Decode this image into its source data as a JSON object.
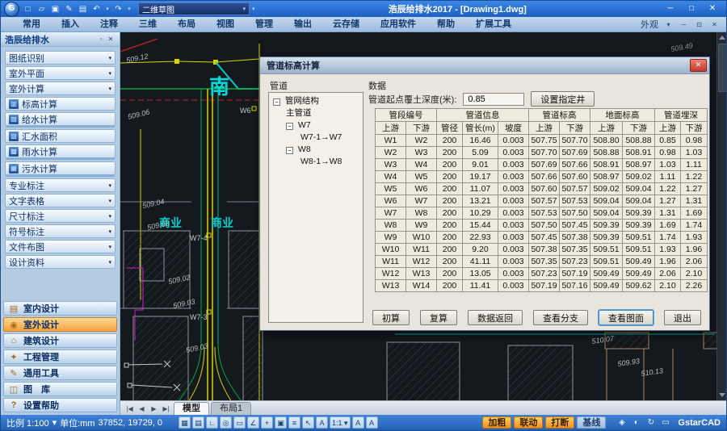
{
  "window": {
    "title": "浩辰给排水2017 - [Drawing1.dwg]",
    "workspace": "二维草图",
    "qat_icons": [
      "□",
      "▱",
      "▣",
      "✎",
      "▤"
    ],
    "undo": "↶",
    "redo": "↷",
    "min": "─",
    "max": "□",
    "close": "✕"
  },
  "ribbon": {
    "tabs": [
      "常用",
      "插入",
      "注释",
      "三维",
      "布局",
      "视图",
      "管理",
      "输出",
      "云存储",
      "应用软件",
      "帮助",
      "扩展工具"
    ],
    "appearance": "外观",
    "appearance_arrow": "▾",
    "mini": [
      "─",
      "⊡",
      "✕"
    ]
  },
  "sidebar": {
    "title": "浩辰给排水",
    "options_icon": "▫",
    "close_icon": "✕",
    "items": [
      {
        "label": "图纸识别",
        "arrow": "▾",
        "icon": "",
        "cls": "grp"
      },
      {
        "label": "室外平面",
        "arrow": "▾",
        "icon": "",
        "cls": "grp"
      },
      {
        "label": "室外计算",
        "arrow": "▾",
        "icon": "",
        "cls": "grp"
      },
      {
        "label": "标高计算",
        "arrow": "",
        "icon": "▥",
        "cls": "tool"
      },
      {
        "label": "给水计算",
        "arrow": "",
        "icon": "▨",
        "cls": "toolsep"
      },
      {
        "label": "汇水面积",
        "arrow": "",
        "icon": "▧",
        "cls": "tool"
      },
      {
        "label": "雨水计算",
        "arrow": "",
        "icon": "▩",
        "cls": "toolsep"
      },
      {
        "label": "污水计算",
        "arrow": "",
        "icon": "▦",
        "cls": "toolsep"
      },
      {
        "label": "专业标注",
        "arrow": "▾",
        "icon": "",
        "cls": "grp"
      },
      {
        "label": "文字表格",
        "arrow": "▾",
        "icon": "",
        "cls": "grp"
      },
      {
        "label": "尺寸标注",
        "arrow": "▾",
        "icon": "",
        "cls": "grp"
      },
      {
        "label": "符号标注",
        "arrow": "▾",
        "icon": "",
        "cls": "grp"
      },
      {
        "label": "文件布图",
        "arrow": "▾",
        "icon": "",
        "cls": "grp"
      },
      {
        "label": "设计资料",
        "arrow": "▾",
        "icon": "",
        "cls": "grp"
      }
    ],
    "modes": [
      {
        "icon": "▤",
        "label": "室内设计",
        "cls": ""
      },
      {
        "icon": "◉",
        "label": "室外设计",
        "cls": "active"
      },
      {
        "icon": "⌂",
        "label": "建筑设计",
        "cls": ""
      },
      {
        "icon": "✦",
        "label": "工程管理",
        "cls": ""
      },
      {
        "icon": "✎",
        "label": "通用工具",
        "cls": ""
      },
      {
        "icon": "◫",
        "label": "图　库",
        "cls": ""
      },
      {
        "icon": "?",
        "label": "设置帮助",
        "cls": ""
      }
    ]
  },
  "canvas": {
    "labels": [
      {
        "text": "509.12"
      },
      {
        "text": "南"
      },
      {
        "text": "W6"
      },
      {
        "text": "509.06"
      },
      {
        "text": "509.04"
      },
      {
        "text": "商业"
      },
      {
        "text": "商业"
      },
      {
        "text": "509.08"
      },
      {
        "text": "W7-4"
      },
      {
        "text": "509.02"
      },
      {
        "text": "509.03"
      },
      {
        "text": "W7-3"
      },
      {
        "text": "509.03"
      },
      {
        "text": "510.07"
      },
      {
        "text": "509.93"
      },
      {
        "text": "510.13"
      },
      {
        "text": "509.49"
      }
    ]
  },
  "model_tabs": {
    "nav": [
      "|◀",
      "◀",
      "▶",
      "▶|"
    ],
    "tabs": [
      {
        "label": "模型",
        "cls": "active"
      },
      {
        "label": "布局1",
        "cls": ""
      }
    ]
  },
  "statusbar": {
    "scale": "比例 1:100",
    "scale_arrow": "▾",
    "units": "单位:mm",
    "coords": "37852, 19729, 0",
    "icons": [
      "▦",
      "▤",
      "∟",
      "◎",
      "▭",
      "∠",
      "+",
      "▣",
      "≡",
      "↖",
      "A",
      "1:1 ▾",
      "A",
      "A"
    ],
    "toggles": [
      {
        "label": "加粗",
        "cls": "on"
      },
      {
        "label": "联动",
        "cls": "on"
      },
      {
        "label": "打断",
        "cls": "on"
      },
      {
        "label": "基线",
        "cls": ""
      }
    ],
    "right_icons": [
      "◈",
      "◐",
      "↻",
      "▭"
    ],
    "brand": "GstarCAD"
  },
  "dialog": {
    "title": "管道标高计算",
    "close_glyph": "✕",
    "pipe_label": "管道",
    "data_label": "数据",
    "depth_label": "管道起点覆土深度(米):",
    "depth_value": "0.85",
    "set_well": "设置指定井",
    "tree": [
      {
        "cls": "lv0",
        "g": "box",
        "glyph": "−",
        "label": "管网结构"
      },
      {
        "cls": "lv1",
        "g": "",
        "glyph": "",
        "label": "主管道"
      },
      {
        "cls": "lv1",
        "g": "box",
        "glyph": "−",
        "label": "W7"
      },
      {
        "cls": "lv2",
        "g": "",
        "glyph": "",
        "label": "W7-1→W7"
      },
      {
        "cls": "lv1",
        "g": "box",
        "glyph": "−",
        "label": "W8"
      },
      {
        "cls": "lv2",
        "g": "",
        "glyph": "",
        "label": "W8-1→W8"
      }
    ],
    "table": {
      "groups": [
        "管段编号",
        "管道信息",
        "管道标高",
        "地面标高",
        "管道埋深"
      ],
      "columns": [
        "上游",
        "下游",
        "管径",
        "管长(m)",
        "坡度",
        "上游",
        "下游",
        "上游",
        "下游",
        "上游",
        "下游"
      ],
      "rows": [
        [
          "W1",
          "W2",
          "200",
          "16.46",
          "0.003",
          "507.75",
          "507.70",
          "508.80",
          "508.88",
          "0.85",
          "0.98"
        ],
        [
          "W2",
          "W3",
          "200",
          "5.09",
          "0.003",
          "507.70",
          "507.69",
          "508.88",
          "508.91",
          "0.98",
          "1.03"
        ],
        [
          "W3",
          "W4",
          "200",
          "9.01",
          "0.003",
          "507.69",
          "507.66",
          "508.91",
          "508.97",
          "1.03",
          "1.11"
        ],
        [
          "W4",
          "W5",
          "200",
          "19.17",
          "0.003",
          "507.66",
          "507.60",
          "508.97",
          "509.02",
          "1.11",
          "1.22"
        ],
        [
          "W5",
          "W6",
          "200",
          "11.07",
          "0.003",
          "507.60",
          "507.57",
          "509.02",
          "509.04",
          "1.22",
          "1.27"
        ],
        [
          "W6",
          "W7",
          "200",
          "13.21",
          "0.003",
          "507.57",
          "507.53",
          "509.04",
          "509.04",
          "1.27",
          "1.31"
        ],
        [
          "W7",
          "W8",
          "200",
          "10.29",
          "0.003",
          "507.53",
          "507.50",
          "509.04",
          "509.39",
          "1.31",
          "1.69"
        ],
        [
          "W8",
          "W9",
          "200",
          "15.44",
          "0.003",
          "507.50",
          "507.45",
          "509.39",
          "509.39",
          "1.69",
          "1.74"
        ],
        [
          "W9",
          "W10",
          "200",
          "22.93",
          "0.003",
          "507.45",
          "507.38",
          "509.39",
          "509.51",
          "1.74",
          "1.93"
        ],
        [
          "W10",
          "W11",
          "200",
          "9.20",
          "0.003",
          "507.38",
          "507.35",
          "509.51",
          "509.51",
          "1.93",
          "1.96"
        ],
        [
          "W11",
          "W12",
          "200",
          "41.11",
          "0.003",
          "507.35",
          "507.23",
          "509.51",
          "509.49",
          "1.96",
          "2.06"
        ],
        [
          "W12",
          "W13",
          "200",
          "13.05",
          "0.003",
          "507.23",
          "507.19",
          "509.49",
          "509.49",
          "2.06",
          "2.10"
        ],
        [
          "W13",
          "W14",
          "200",
          "11.41",
          "0.003",
          "507.19",
          "507.16",
          "509.49",
          "509.62",
          "2.10",
          "2.26"
        ]
      ]
    },
    "buttons": [
      {
        "label": "初算",
        "cls": ""
      },
      {
        "label": "复算",
        "cls": ""
      },
      {
        "label": "数据返回",
        "cls": ""
      },
      {
        "label": "查看分支",
        "cls": ""
      },
      {
        "label": "查看图面",
        "cls": "focus"
      },
      {
        "label": "退出",
        "cls": ""
      }
    ]
  }
}
